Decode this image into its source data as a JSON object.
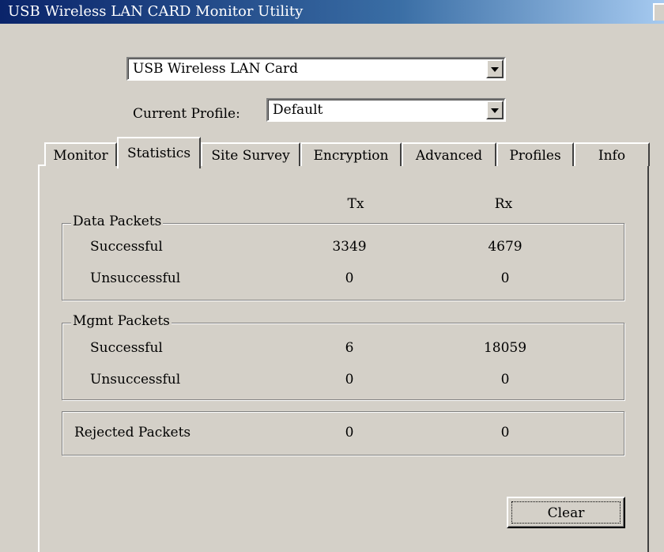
{
  "window": {
    "title": "USB Wireless LAN CARD Monitor Utility"
  },
  "adapter_select": {
    "value": "USB Wireless LAN Card"
  },
  "profile": {
    "label": "Current Profile:",
    "value": "Default"
  },
  "tabs": [
    {
      "label": "Monitor"
    },
    {
      "label": "Statistics"
    },
    {
      "label": "Site Survey"
    },
    {
      "label": "Encryption"
    },
    {
      "label": "Advanced"
    },
    {
      "label": "Profiles"
    },
    {
      "label": "Info"
    }
  ],
  "stats": {
    "col_tx": "Tx",
    "col_rx": "Rx",
    "data_packets": {
      "title": "Data Packets",
      "successful": {
        "label": "Successful",
        "tx": "3349",
        "rx": "4679"
      },
      "unsuccessful": {
        "label": "Unsuccessful",
        "tx": "0",
        "rx": "0"
      }
    },
    "mgmt_packets": {
      "title": "Mgmt Packets",
      "successful": {
        "label": "Successful",
        "tx": "6",
        "rx": "18059"
      },
      "unsuccessful": {
        "label": "Unsuccessful",
        "tx": "0",
        "rx": "0"
      }
    },
    "rejected": {
      "label": "Rejected Packets",
      "tx": "0",
      "rx": "0"
    }
  },
  "buttons": {
    "clear": "Clear"
  }
}
